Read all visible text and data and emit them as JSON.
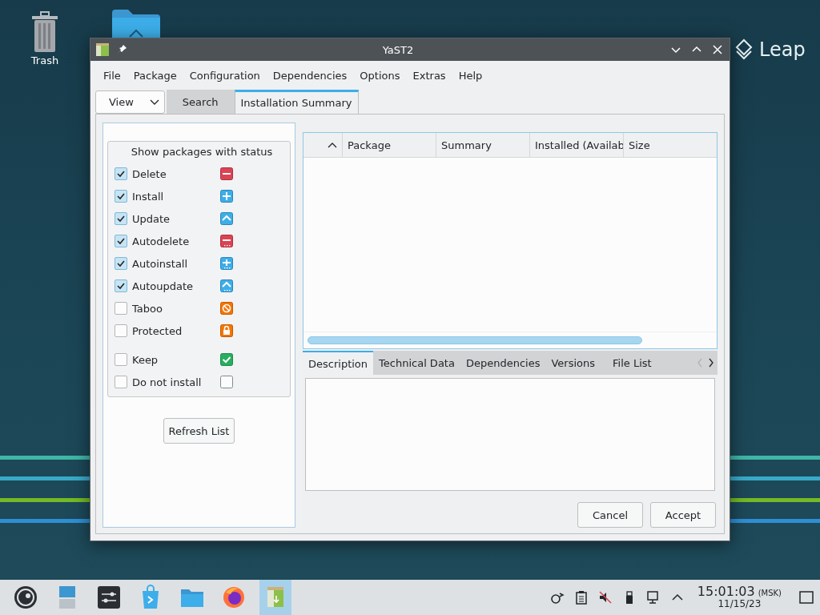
{
  "desktop": {
    "icons": [
      {
        "label": "Trash"
      }
    ],
    "brand": "Leap"
  },
  "window": {
    "title": "YaST2"
  },
  "menu": [
    "File",
    "Package",
    "Configuration",
    "Dependencies",
    "Options",
    "Extras",
    "Help"
  ],
  "view_button": "View",
  "tabs": [
    {
      "label": "Search",
      "selected": false
    },
    {
      "label": "Installation Summary",
      "selected": true
    }
  ],
  "filter": {
    "title": "Show packages with status",
    "items": [
      {
        "label": "Delete",
        "checked": true,
        "kind": "delete"
      },
      {
        "label": "Install",
        "checked": true,
        "kind": "install"
      },
      {
        "label": "Update",
        "checked": true,
        "kind": "update"
      },
      {
        "label": "Autodelete",
        "checked": true,
        "kind": "autodelete"
      },
      {
        "label": "Autoinstall",
        "checked": true,
        "kind": "autoinstall"
      },
      {
        "label": "Autoupdate",
        "checked": true,
        "kind": "autoupdate"
      },
      {
        "label": "Taboo",
        "checked": false,
        "kind": "taboo"
      },
      {
        "label": "Protected",
        "checked": false,
        "kind": "protected"
      },
      {
        "label": "Keep",
        "checked": false,
        "kind": "keep"
      },
      {
        "label": "Do not install",
        "checked": false,
        "kind": "noinst"
      }
    ]
  },
  "refresh_button": "Refresh List",
  "table": {
    "columns": [
      "Package",
      "Summary",
      "Installed (Availab",
      "Size"
    ]
  },
  "detail_tabs": [
    {
      "label": "Description",
      "selected": true
    },
    {
      "label": "Technical Data",
      "selected": false
    },
    {
      "label": "Dependencies",
      "selected": false
    },
    {
      "label": "Versions",
      "selected": false
    },
    {
      "label": "File List",
      "selected": false
    }
  ],
  "buttons": [
    "Cancel",
    "Accept"
  ],
  "taskbar": {
    "time": "15:01:03",
    "timezone": "(MSK)",
    "date": "11/15/23"
  }
}
